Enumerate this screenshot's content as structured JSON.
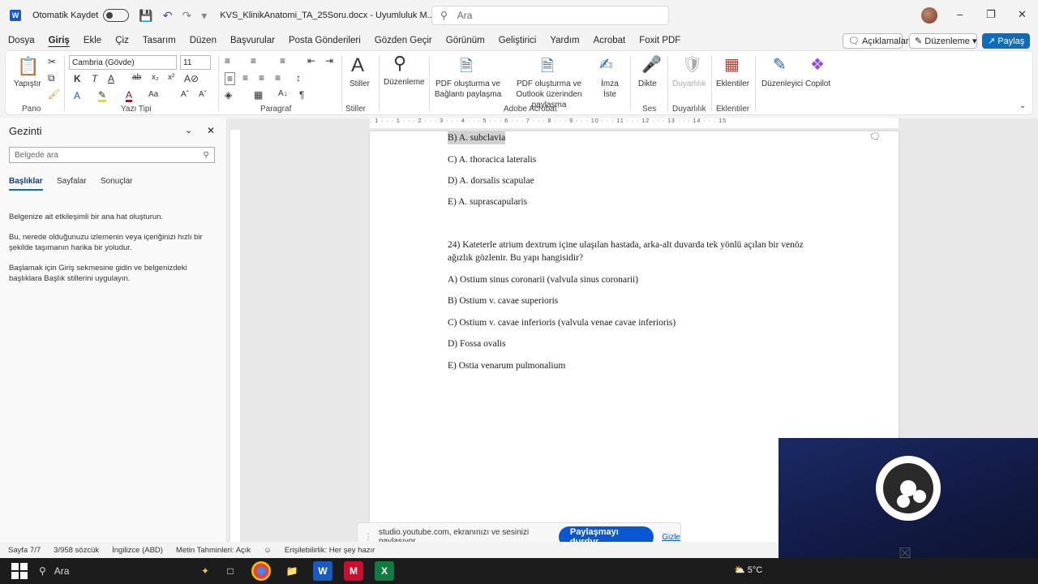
{
  "titlebar": {
    "app_logo": "W",
    "autosave_label": "Otomatik Kaydet",
    "doc_title": "KVS_KlinikAnatomi_TA_25Soru.docx  -  Uyumluluk M...",
    "search_placeholder": "Ara"
  },
  "menu": {
    "items": [
      "Dosya",
      "Giriş",
      "Ekle",
      "Çiz",
      "Tasarım",
      "Düzen",
      "Başvurular",
      "Posta Gönderileri",
      "Gözden Geçir",
      "Görünüm",
      "Geliştirici",
      "Yardım",
      "Acrobat",
      "Foxit PDF"
    ],
    "comments_btn": "Açıklamalar",
    "editing_btn": "Düzenleme",
    "share_btn": "Paylaş"
  },
  "ribbon": {
    "paste_label": "Yapıştır",
    "clipboard_group": "Pano",
    "font_name": "Cambria (Gövde)",
    "font_size": "11",
    "font_group": "Yazı Tipi",
    "paragraph_group": "Paragraf",
    "styles_label": "Stiller",
    "styles_group": "Stiller",
    "editing_label": "Düzenleme",
    "pdf_share_label": "PDF oluşturma ve Bağlantı paylaşma",
    "pdf_outlook_label": "PDF oluşturma ve Outlook üzerinden paylaşma",
    "sign_label": "İmza İste",
    "acrobat_group": "Adobe Acrobat",
    "dictate_label": "Dikte",
    "voice_group": "Ses",
    "sensitivity_label": "Duyarlılık",
    "sensitivity_group": "Duyarlılık",
    "addins_label": "Eklentiler",
    "addins_group": "Eklentiler",
    "editor_label": "Düzenleyici",
    "copilot_label": "Copilot"
  },
  "nav": {
    "title": "Gezinti",
    "search_placeholder": "Belgede ara",
    "tabs": [
      "Başlıklar",
      "Sayfalar",
      "Sonuçlar"
    ],
    "help1": "Belgenize ait etkileşimli bir ana hat oluşturun.",
    "help2": "Bu, nerede olduğunuzu izlemenin veya içeriğinizi hızlı bir şekilde taşımanın harika bir yoludur.",
    "help3": "Başlamak için Giriş sekmesine gidin ve belgenizdeki başlıklara Başlık stillerini uygulayın."
  },
  "ruler_text": "· 1 · · · 1 · · · 2 · · · 3 · · · 4 · · · 5 · · · 6 · · · 7 · · · 8 · · · 9 · · · 10 · · · 11 · · · 12 · · · 13 · · · 14 · · · 15",
  "document": {
    "lines_prev": [
      "B) A. subclavia",
      "C) A. thoracica lateralis",
      "D) A. dorsalis scapulae",
      "E) A. suprascapularis"
    ],
    "question": "24) Kateterle atrium dextrum içine ulaşılan hastada, arka-alt duvarda tek yönlü açılan bir venöz ağızlık gözlenir. Bu yapı hangisidir?",
    "options": [
      "A) Ostium sinus coronarii (valvula sinus coronarii)",
      "B) Ostium v. cavae superioris",
      "C) Ostium v. cavae inferioris (valvula venae cavae inferioris)",
      "D) Fossa ovalis",
      "E) Ostia venarum pulmonalium"
    ]
  },
  "sharebar": {
    "message": "studio.youtube.com, ekranınızı ve sesinizi paylaşıyor.",
    "stop_btn": "Paylaşmayı durdur",
    "hide_link": "Gizle"
  },
  "status": {
    "page": "Sayfa 7/7",
    "words": "3/958 sözcük",
    "language": "İngilizce (ABD)",
    "predictions": "Metin Tahminleri: Açık",
    "accessibility": "Erişilebilirlik: Her şey hazır"
  },
  "taskbar": {
    "search_placeholder": "Ara",
    "weather": "5°C"
  }
}
